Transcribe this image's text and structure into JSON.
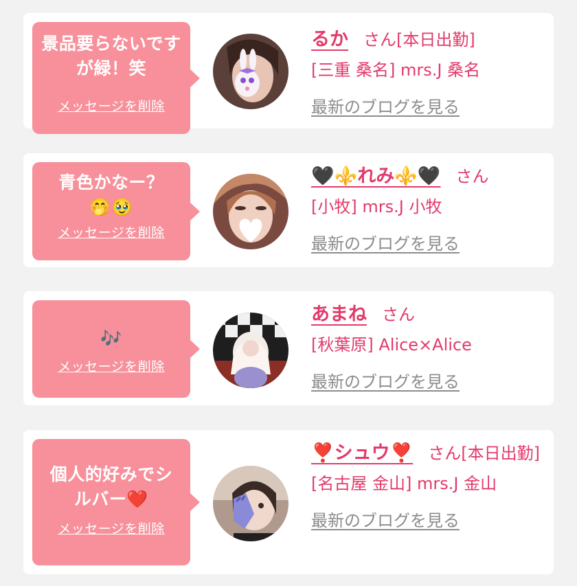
{
  "delete_label": "メッセージを削除",
  "blog_label": "最新のブログを見る",
  "honorific": "さん",
  "colors": {
    "accent": "#e23a6a",
    "bubble": "#f7909a",
    "muted": "#8c8c8c"
  },
  "cards": [
    {
      "message": "景品要らないですが緑！笑",
      "name": "るか",
      "suffix": "さん[本日出勤]",
      "shop": "[三重 桑名] mrs.J 桑名"
    },
    {
      "message": "青色かなー？🤭🥹",
      "name": "🖤⚜️れみ⚜️🖤",
      "suffix": "さん",
      "shop": "[小牧] mrs.J 小牧"
    },
    {
      "message": "🎶",
      "name": "あまね",
      "suffix": "さん",
      "shop": "[秋葉原] Alice×Alice"
    },
    {
      "message": "個人的好みでシルバー❤️",
      "name": "❣️シュウ❣️",
      "suffix": "さん[本日出勤]",
      "shop": "[名古屋 金山] mrs.J 金山"
    }
  ]
}
